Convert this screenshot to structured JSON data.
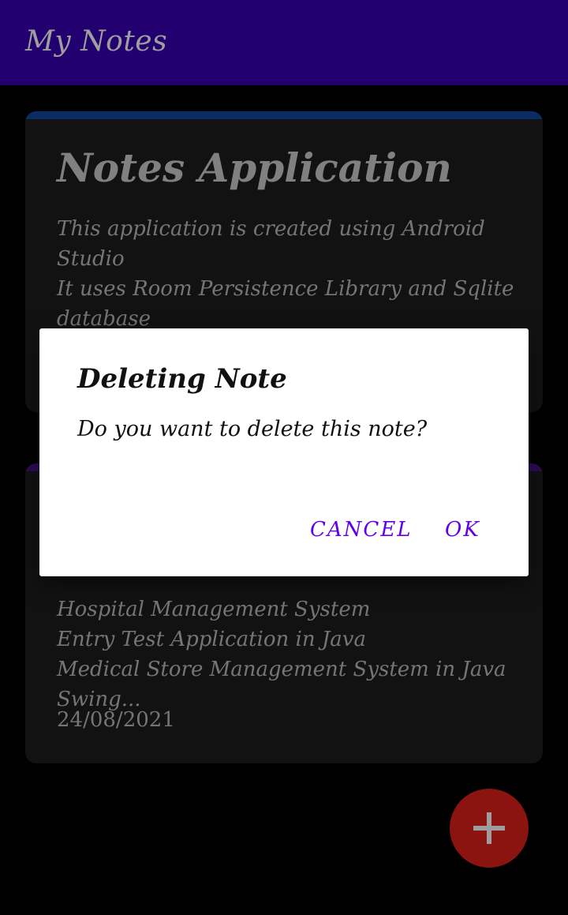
{
  "app_bar": {
    "title": "My Notes",
    "color": "#3700B3"
  },
  "notes": [
    {
      "title": "Notes Application",
      "accent_color": "#0D47A1",
      "body_lines": [
        "This application is created using Android",
        "Studio",
        "It uses Room Persistence Library and Sqlite",
        "database"
      ],
      "date": ""
    },
    {
      "title": "",
      "accent_color": "#4A148C",
      "body_lines": [
        "",
        "Hospital Management System",
        "Entry Test Application in Java",
        "Medical Store Management System in Java",
        "Swing..."
      ],
      "date": "24/08/2021"
    }
  ],
  "fab": {
    "icon": "plus-icon",
    "color": "#E0201B"
  },
  "dialog": {
    "title": "Deleting Note",
    "message": "Do you want to delete this note?",
    "cancel_label": "CANCEL",
    "ok_label": "OK",
    "button_color": "#6200EE"
  }
}
